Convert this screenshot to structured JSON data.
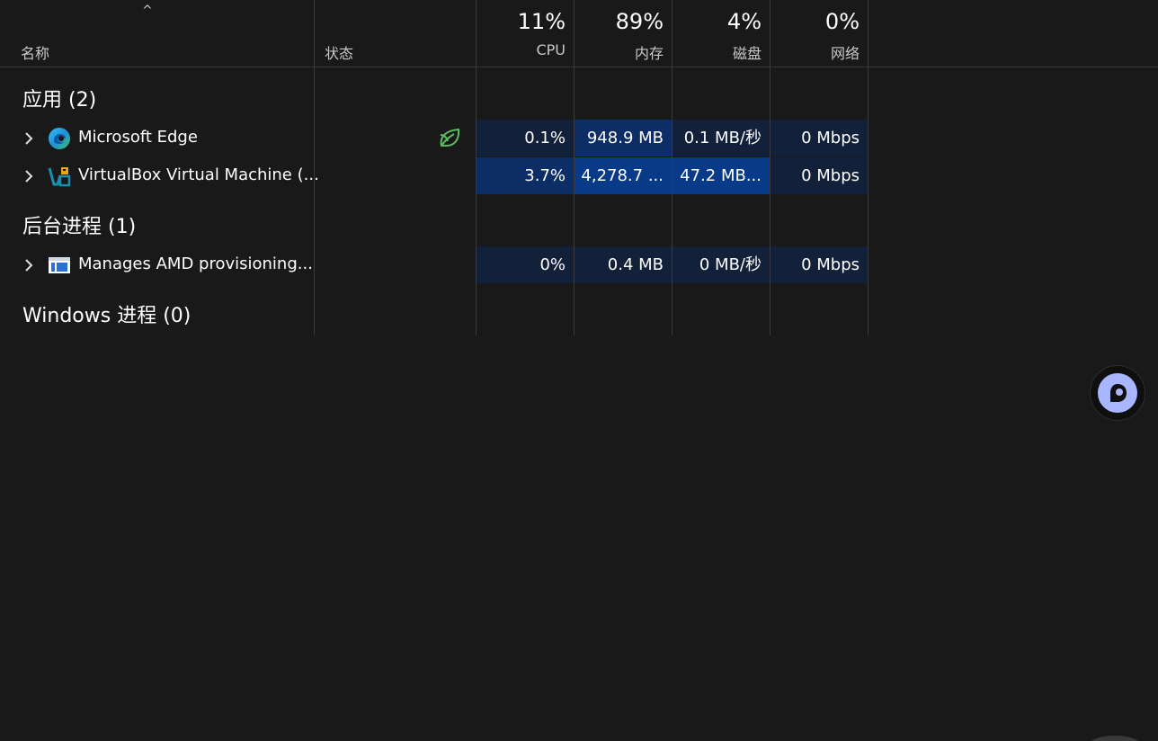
{
  "header": {
    "sort_indicator": "^",
    "name_label": "名称",
    "status_label": "状态",
    "cpu": {
      "pct": "11%",
      "label": "CPU"
    },
    "memory": {
      "pct": "89%",
      "label": "内存"
    },
    "disk": {
      "pct": "4%",
      "label": "磁盘"
    },
    "network": {
      "pct": "0%",
      "label": "网络"
    }
  },
  "groups": {
    "apps": {
      "title": "应用 (2)"
    },
    "background": {
      "title": "后台进程 (1)"
    },
    "windows": {
      "title": "Windows 进程 (0)"
    }
  },
  "rows": [
    {
      "name": "Microsoft Edge",
      "icon": "edge-icon",
      "status_icon": "efficiency-mode-leaf-icon",
      "cpu": "0.1%",
      "memory": "948.9 MB",
      "disk": "0.1 MB/秒",
      "network": "0 Mbps"
    },
    {
      "name": "VirtualBox Virtual Machine (...",
      "icon": "virtualbox-icon",
      "cpu": "3.7%",
      "memory": "4,278.7 ...",
      "disk": "47.2 MB...",
      "network": "0 Mbps"
    },
    {
      "name": "Manages AMD provisioning...",
      "icon": "window-app-icon",
      "cpu": "0%",
      "memory": "0.4 MB",
      "disk": "0 MB/秒",
      "network": "0 Mbps"
    }
  ],
  "colors": {
    "background": "#191919",
    "heat_low": "#12203a",
    "heat_mid": "#0d2d66",
    "heat_high": "#083a8a",
    "divider": "#3a3a3a",
    "leaf": "#5dbb63",
    "copilot": "#a8b6ff"
  }
}
